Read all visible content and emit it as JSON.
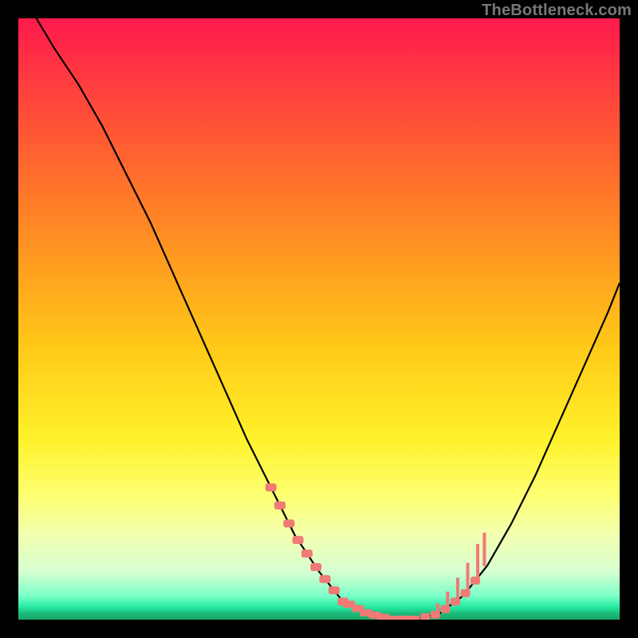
{
  "watermark": "TheBottleneck.com",
  "chart_data": {
    "type": "line",
    "title": "",
    "xlabel": "",
    "ylabel": "",
    "xlim": [
      0,
      100
    ],
    "ylim": [
      0,
      100
    ],
    "grid": false,
    "series": [
      {
        "name": "curve",
        "color": "#000000",
        "x": [
          3,
          6,
          10,
          14,
          18,
          22,
          26,
          30,
          34,
          38,
          42,
          46,
          50,
          54,
          58,
          62,
          66,
          70,
          74,
          78,
          82,
          86,
          90,
          94,
          98,
          100
        ],
        "y": [
          100,
          95,
          89,
          82,
          74,
          66,
          57,
          48,
          39,
          30,
          22,
          14,
          8,
          3,
          1,
          0,
          0,
          1,
          4,
          9,
          16,
          24,
          33,
          42,
          51,
          56
        ]
      }
    ],
    "annotations": {
      "markers_color": "#ef7a76",
      "left_branch_markers_x_range": [
        42,
        54
      ],
      "right_branch_markers_x_range": [
        66,
        76
      ],
      "valley_markers_x_range": [
        55,
        65
      ]
    }
  }
}
